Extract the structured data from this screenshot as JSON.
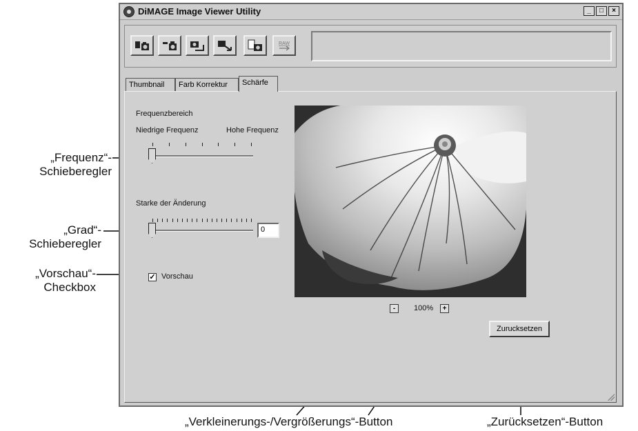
{
  "window": {
    "title": "DiMAGE Image Viewer Utility",
    "controls": [
      "_",
      "□",
      "×"
    ]
  },
  "toolbar": {
    "buttons": [
      {
        "icon": "camera-transfer-icon"
      },
      {
        "icon": "camera-import-icon"
      },
      {
        "icon": "camera-rotate-icon"
      },
      {
        "icon": "camera-export-icon"
      },
      {
        "icon": "camera-file-icon"
      },
      {
        "icon": "raw-icon",
        "label": "RAW"
      }
    ]
  },
  "tabs": [
    {
      "label": "Thumbnail",
      "active": false
    },
    {
      "label": "Farb Korrektur",
      "active": false
    },
    {
      "label": "Schärfe",
      "active": true
    }
  ],
  "sharpness": {
    "frequency_title": "Frequenzbereich",
    "low_label": "Niedrige Frequenz",
    "high_label": "Hohe Frequenz",
    "frequency_value": 0,
    "strength_title": "Starke der Änderung",
    "strength_value": "0",
    "preview_label": "Vorschau",
    "preview_checked": true
  },
  "zoom": {
    "minus": "-",
    "plus": "+",
    "value": "100%"
  },
  "reset_label": "Zurucksetzen",
  "callouts": {
    "frequenz": "„Frequenz“-\nSchieberegler",
    "grad": "„Grad“-\nSchieberegler",
    "vorschau": "„Vorschau“-\nCheckbox",
    "zoom": "„Verkleinerungs-/Vergrößerungs“-Button",
    "reset": "„Zurücksetzen“-Button"
  }
}
